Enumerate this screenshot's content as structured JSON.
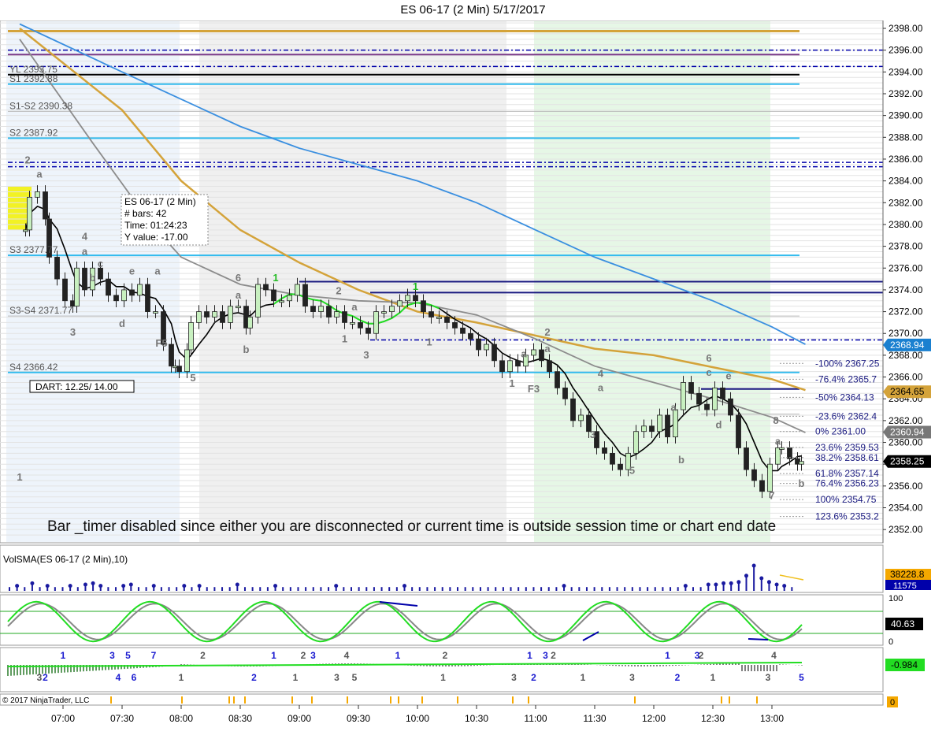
{
  "window": {
    "title": "ES 06-17 (2 Min)  5/17/2017",
    "copyright": "© 2017 NinjaTrader, LLC"
  },
  "colors": {
    "gold_ma": "#d4a33a",
    "blue_ma": "#3a8fe0",
    "gray_ma": "#8c8c8c",
    "black_ma": "#000000",
    "green": "#22dd22",
    "navy": "#0000aa",
    "cyan_level": "#33bbee",
    "up_candle": "#c8f0c0",
    "down_candle": "#222222"
  },
  "chart_data": [
    {
      "type": "line",
      "name": "price-panel",
      "instrument": "ES 06-17 (2 Min)",
      "date": "5/17/2017",
      "ylim": [
        2351.0,
        2398.5
      ],
      "y_ticks": [
        2352.0,
        2354.0,
        2356.0,
        2358.0,
        2360.0,
        2362.0,
        2364.0,
        2366.0,
        2368.0,
        2370.0,
        2372.0,
        2374.0,
        2376.0,
        2378.0,
        2380.0,
        2382.0,
        2384.0,
        2386.0,
        2388.0,
        2390.0,
        2392.0,
        2394.0,
        2396.0,
        2398.0
      ],
      "x_labels": [
        "07:00",
        "07:30",
        "08:00",
        "08:30",
        "09:00",
        "09:30",
        "10:00",
        "10:30",
        "11:00",
        "11:30",
        "12:00",
        "12:30",
        "13:00"
      ],
      "price_markers": [
        {
          "value": "2368.94",
          "price": 2368.94,
          "color": "#1a80d0"
        },
        {
          "value": "2364.65",
          "price": 2364.65,
          "color": "#d4a33a"
        },
        {
          "value": "2360.94",
          "price": 2360.94,
          "color": "#777777"
        },
        {
          "value": "2358.25",
          "price": 2358.25,
          "color": "#000000"
        }
      ],
      "level_labels": [
        {
          "text": "S1-S2 2390.38",
          "price": 2390.38
        },
        {
          "text": "S2 2387.92",
          "price": 2387.92
        },
        {
          "text": "S3 2377.77",
          "price": 2377.17
        },
        {
          "text": "S3-S4 2371.77",
          "price": 2371.6
        },
        {
          "text": "S4 2366.42",
          "price": 2366.42
        },
        {
          "text": "YL 2393.75",
          "price": 2393.75
        },
        {
          "text": "S1 2392.88",
          "price": 2392.88
        }
      ],
      "fib_labels": [
        {
          "text": "-100%  2367.25",
          "price": 2367.25
        },
        {
          "text": "-76.4%  2365.7",
          "price": 2365.8
        },
        {
          "text": "-50%  2364.13",
          "price": 2364.13
        },
        {
          "text": "-23.6%  2362.4",
          "price": 2362.4
        },
        {
          "text": "0%  2361.00",
          "price": 2361.0
        },
        {
          "text": "23.6%  2359.53",
          "price": 2359.53
        },
        {
          "text": "38.2%  2358.61",
          "price": 2358.61
        },
        {
          "text": "61.8%  2357.14",
          "price": 2357.14
        },
        {
          "text": "76.4%  2356.23",
          "price": 2356.23
        },
        {
          "text": "100%  2354.75",
          "price": 2354.75
        },
        {
          "text": "123.6%  2353.2",
          "price": 2353.2
        }
      ],
      "dart": "DART:  12.25/ 14.00",
      "info_box": [
        "ES 06-17 (2 Min)",
        "# bars:   42",
        "Time:      01:24:23",
        "Y value:  -17.00"
      ],
      "message": "Bar _timer disabled since either you are disconnected or current time is outside session time or chart end date",
      "close_series": {
        "x": [
          "06:41",
          "06:43",
          "06:47",
          "06:51",
          "06:53",
          "06:57",
          "07:01",
          "07:05",
          "07:07",
          "07:11",
          "07:15",
          "07:19",
          "07:23",
          "07:27",
          "07:31",
          "07:35",
          "07:39",
          "07:43",
          "07:47",
          "07:51",
          "07:55",
          "07:57",
          "07:59",
          "08:03",
          "08:05",
          "08:09",
          "08:13",
          "08:17",
          "08:21",
          "08:25",
          "08:29",
          "08:33",
          "08:35",
          "08:39",
          "08:43",
          "08:47",
          "08:51",
          "08:55",
          "08:59",
          "09:03",
          "09:07",
          "09:11",
          "09:15",
          "09:19",
          "09:23",
          "09:27",
          "09:31",
          "09:35",
          "09:39",
          "09:43",
          "09:47",
          "09:51",
          "09:55",
          "09:59",
          "10:03",
          "10:07",
          "10:11",
          "10:15",
          "10:19",
          "10:23",
          "10:27",
          "10:31",
          "10:35",
          "10:39",
          "10:43",
          "10:47",
          "10:51",
          "10:55",
          "10:59",
          "11:03",
          "11:07",
          "11:11",
          "11:15",
          "11:19",
          "11:23",
          "11:27",
          "11:31",
          "11:35",
          "11:39",
          "11:43",
          "11:47",
          "11:51",
          "11:55",
          "11:59",
          "12:03",
          "12:07",
          "12:11",
          "12:15",
          "12:19",
          "12:23",
          "12:27",
          "12:31",
          "12:35",
          "12:39",
          "12:43",
          "12:47",
          "12:51",
          "12:55",
          "12:59",
          "13:03",
          "13:05",
          "13:09",
          "13:13",
          "13:15"
        ],
        "y": [
          2379.5,
          2382.5,
          2383.0,
          2380.5,
          2377.0,
          2375.0,
          2373.0,
          2372.5,
          2376.0,
          2374.0,
          2376.0,
          2375.0,
          2373.5,
          2373.0,
          2374.0,
          2373.5,
          2374.5,
          2372.0,
          2372.0,
          2369.0,
          2367.0,
          2367.0,
          2366.5,
          2368.5,
          2371.0,
          2372.0,
          2371.5,
          2372.0,
          2371.0,
          2372.5,
          2372.5,
          2370.5,
          2371.5,
          2374.5,
          2374.0,
          2373.0,
          2373.0,
          2373.5,
          2374.5,
          2372.5,
          2372.0,
          2372.5,
          2371.5,
          2372.0,
          2371.0,
          2371.0,
          2370.5,
          2370.0,
          2372.0,
          2372.0,
          2372.5,
          2373.0,
          2373.5,
          2373.0,
          2372.0,
          2371.5,
          2371.5,
          2371.0,
          2370.5,
          2370.0,
          2369.5,
          2368.5,
          2369.0,
          2367.5,
          2366.5,
          2367.5,
          2367.0,
          2368.0,
          2368.5,
          2367.5,
          2366.5,
          2365.0,
          2364.0,
          2362.0,
          2362.5,
          2361.0,
          2359.5,
          2359.0,
          2358.0,
          2357.5,
          2359.0,
          2361.0,
          2361.5,
          2361.0,
          2362.5,
          2360.5,
          2363.0,
          2365.5,
          2364.5,
          2363.5,
          2363.0,
          2365.0,
          2364.0,
          2362.5,
          2359.5,
          2357.5,
          2356.5,
          2355.5,
          2358.0,
          2359.5,
          2359.5,
          2358.5,
          2358.0,
          2358.25
        ]
      },
      "moving_averages": [
        {
          "name": "gold",
          "x": [
            "06:38",
            "07:30",
            "08:00",
            "08:30",
            "09:00",
            "09:30",
            "10:00",
            "10:30",
            "11:00",
            "11:30",
            "12:00",
            "12:30",
            "13:00",
            "13:17"
          ],
          "y": [
            2398.0,
            2390.5,
            2384.0,
            2379.5,
            2376.5,
            2374.0,
            2372.0,
            2371.0,
            2369.8,
            2368.6,
            2368.0,
            2366.9,
            2365.8,
            2364.8
          ]
        },
        {
          "name": "blue",
          "x": [
            "06:38",
            "07:30",
            "08:00",
            "08:30",
            "09:00",
            "09:30",
            "10:00",
            "10:30",
            "11:00",
            "11:30",
            "12:00",
            "12:30",
            "13:00",
            "13:17"
          ],
          "y": [
            2398.4,
            2394.0,
            2391.5,
            2389.0,
            2387.0,
            2385.5,
            2384.0,
            2382.0,
            2379.5,
            2377.0,
            2375.0,
            2373.0,
            2370.6,
            2369.0
          ]
        },
        {
          "name": "gray",
          "x": [
            "06:38",
            "07:15",
            "07:45",
            "08:00",
            "08:30",
            "09:00",
            "09:30",
            "10:00",
            "10:30",
            "11:00",
            "11:30",
            "12:00",
            "12:30",
            "13:00",
            "13:17"
          ],
          "y": [
            2397.0,
            2387.5,
            2380.0,
            2377.0,
            2374.5,
            2373.5,
            2373.0,
            2372.8,
            2371.7,
            2369.5,
            2367.0,
            2365.5,
            2364.0,
            2362.3,
            2360.9
          ]
        }
      ]
    },
    {
      "type": "bar",
      "name": "volume-panel",
      "title": "VolSMA(ES 06-17 (2 Min),10)",
      "markers": [
        "38228.8",
        "11575"
      ]
    },
    {
      "type": "line",
      "name": "stochastic-panel",
      "ylim": [
        0,
        100
      ],
      "y_ticks": [
        0,
        100
      ],
      "marker": "40.63"
    },
    {
      "type": "line",
      "name": "oscillator-panel",
      "marker": "-0.984",
      "labels": [
        {
          "t": "07:00",
          "text": "1",
          "c": "blue",
          "p": "top"
        },
        {
          "t": "07:25",
          "text": "3",
          "c": "blue",
          "p": "top"
        },
        {
          "t": "07:33",
          "text": "5",
          "c": "blue",
          "p": "top"
        },
        {
          "t": "07:46",
          "text": "7",
          "c": "blue",
          "p": "top"
        },
        {
          "t": "08:47",
          "text": "1",
          "c": "blue",
          "p": "top"
        },
        {
          "t": "09:07",
          "text": "3",
          "c": "blue",
          "p": "top"
        },
        {
          "t": "09:50",
          "text": "1",
          "c": "blue",
          "p": "top"
        },
        {
          "t": "10:57",
          "text": "1",
          "c": "blue",
          "p": "top"
        },
        {
          "t": "11:05",
          "text": "3",
          "c": "blue",
          "p": "top"
        },
        {
          "t": "12:07",
          "text": "1",
          "c": "blue",
          "p": "top"
        },
        {
          "t": "12:22",
          "text": "3",
          "c": "blue",
          "p": "top"
        },
        {
          "t": "08:11",
          "text": "2",
          "c": "gray",
          "p": "top"
        },
        {
          "t": "09:02",
          "text": "2",
          "c": "gray",
          "p": "top"
        },
        {
          "t": "09:24",
          "text": "4",
          "c": "gray",
          "p": "top"
        },
        {
          "t": "10:14",
          "text": "2",
          "c": "gray",
          "p": "top"
        },
        {
          "t": "11:09",
          "text": "2",
          "c": "gray",
          "p": "top"
        },
        {
          "t": "12:24",
          "text": "2",
          "c": "gray",
          "p": "top"
        },
        {
          "t": "13:01",
          "text": "4",
          "c": "gray",
          "p": "top"
        },
        {
          "t": "06:48",
          "text": "3",
          "c": "gray",
          "p": "bot"
        },
        {
          "t": "06:51",
          "text": "2",
          "c": "blue",
          "p": "bot"
        },
        {
          "t": "07:28",
          "text": "4",
          "c": "blue",
          "p": "bot"
        },
        {
          "t": "07:36",
          "text": "6",
          "c": "blue",
          "p": "bot"
        },
        {
          "t": "08:00",
          "text": "1",
          "c": "gray",
          "p": "bot"
        },
        {
          "t": "08:37",
          "text": "2",
          "c": "blue",
          "p": "bot"
        },
        {
          "t": "08:58",
          "text": "1",
          "c": "gray",
          "p": "bot"
        },
        {
          "t": "09:19",
          "text": "3",
          "c": "gray",
          "p": "bot"
        },
        {
          "t": "09:28",
          "text": "5",
          "c": "gray",
          "p": "bot"
        },
        {
          "t": "10:13",
          "text": "1",
          "c": "gray",
          "p": "bot"
        },
        {
          "t": "10:49",
          "text": "3",
          "c": "gray",
          "p": "bot"
        },
        {
          "t": "10:59",
          "text": "2",
          "c": "blue",
          "p": "bot"
        },
        {
          "t": "11:24",
          "text": "1",
          "c": "gray",
          "p": "bot"
        },
        {
          "t": "11:49",
          "text": "3",
          "c": "gray",
          "p": "bot"
        },
        {
          "t": "12:12",
          "text": "2",
          "c": "blue",
          "p": "bot"
        },
        {
          "t": "12:30",
          "text": "1",
          "c": "gray",
          "p": "bot"
        },
        {
          "t": "12:58",
          "text": "3",
          "c": "gray",
          "p": "bot"
        },
        {
          "t": "13:15",
          "text": "5",
          "c": "blue",
          "p": "bot"
        }
      ]
    },
    {
      "type": "bar",
      "name": "signal-panel",
      "marker": "0"
    }
  ],
  "wave_labels": [
    {
      "t": "06:38",
      "price": 2356.5,
      "text": "1",
      "c": "gray"
    },
    {
      "t": "06:42",
      "price": 2385.6,
      "text": "2",
      "c": "gray"
    },
    {
      "t": "06:48",
      "price": 2384.3,
      "text": "a",
      "c": "gray"
    },
    {
      "t": "07:11",
      "price": 2378.6,
      "text": "4",
      "c": "gray"
    },
    {
      "t": "07:11",
      "price": 2377.2,
      "text": "a",
      "c": "gray"
    },
    {
      "t": "07:19",
      "price": 2376.1,
      "text": "c",
      "c": "gray"
    },
    {
      "t": "07:15",
      "price": 2374.8,
      "text": "b",
      "c": "gray"
    },
    {
      "t": "07:35",
      "price": 2375.4,
      "text": "e",
      "c": "gray"
    },
    {
      "t": "07:48",
      "price": 2375.4,
      "text": "a",
      "c": "gray"
    },
    {
      "t": "07:05",
      "price": 2369.8,
      "text": "3",
      "c": "gray"
    },
    {
      "t": "07:30",
      "price": 2370.6,
      "text": "d",
      "c": "gray"
    },
    {
      "t": "07:50",
      "price": 2368.8,
      "text": "F5",
      "c": "gray"
    },
    {
      "t": "08:06",
      "price": 2365.6,
      "text": "5",
      "c": "gray"
    },
    {
      "t": "08:29",
      "price": 2374.8,
      "text": "6",
      "c": "gray"
    },
    {
      "t": "08:29",
      "price": 2373.2,
      "text": "a",
      "c": "gray"
    },
    {
      "t": "08:33",
      "price": 2368.2,
      "text": "b",
      "c": "gray"
    },
    {
      "t": "08:48",
      "price": 2374.8,
      "text": "1",
      "c": "green"
    },
    {
      "t": "09:20",
      "price": 2373.6,
      "text": "2",
      "c": "gray"
    },
    {
      "t": "09:28",
      "price": 2372.1,
      "text": "a",
      "c": "gray"
    },
    {
      "t": "09:23",
      "price": 2369.2,
      "text": "1",
      "c": "gray"
    },
    {
      "t": "09:34",
      "price": 2367.7,
      "text": "3",
      "c": "gray"
    },
    {
      "t": "09:59",
      "price": 2374.0,
      "text": "1",
      "c": "green"
    },
    {
      "t": "10:06",
      "price": 2368.9,
      "text": "1",
      "c": "gray"
    },
    {
      "t": "10:54",
      "price": 2367.8,
      "text": "a",
      "c": "gray"
    },
    {
      "t": "10:48",
      "price": 2365.1,
      "text": "1",
      "c": "gray"
    },
    {
      "t": "10:59",
      "price": 2364.6,
      "text": "F3",
      "c": "gray"
    },
    {
      "t": "11:06",
      "price": 2369.8,
      "text": "2",
      "c": "gray"
    },
    {
      "t": "11:06",
      "price": 2368.3,
      "text": "a",
      "c": "gray"
    },
    {
      "t": "11:33",
      "price": 2366.0,
      "text": "4",
      "c": "gray"
    },
    {
      "t": "11:33",
      "price": 2364.7,
      "text": "a",
      "c": "gray"
    },
    {
      "t": "11:29",
      "price": 2360.4,
      "text": "3",
      "c": "gray"
    },
    {
      "t": "11:49",
      "price": 2357.1,
      "text": "5",
      "c": "gray"
    },
    {
      "t": "12:10",
      "price": 2362.9,
      "text": "a",
      "c": "gray"
    },
    {
      "t": "12:14",
      "price": 2358.1,
      "text": "b",
      "c": "gray"
    },
    {
      "t": "12:28",
      "price": 2367.4,
      "text": "6",
      "c": "gray"
    },
    {
      "t": "12:28",
      "price": 2366.1,
      "text": "c",
      "c": "gray"
    },
    {
      "t": "12:38",
      "price": 2365.8,
      "text": "e",
      "c": "gray"
    },
    {
      "t": "12:33",
      "price": 2361.3,
      "text": "d",
      "c": "gray"
    },
    {
      "t": "13:00",
      "price": 2354.8,
      "text": "7",
      "c": "gray"
    },
    {
      "t": "13:02",
      "price": 2361.7,
      "text": "8",
      "c": "gray"
    },
    {
      "t": "13:03",
      "price": 2359.8,
      "text": "a",
      "c": "gray"
    },
    {
      "t": "13:15",
      "price": 2355.9,
      "text": "b",
      "c": "gray"
    }
  ]
}
